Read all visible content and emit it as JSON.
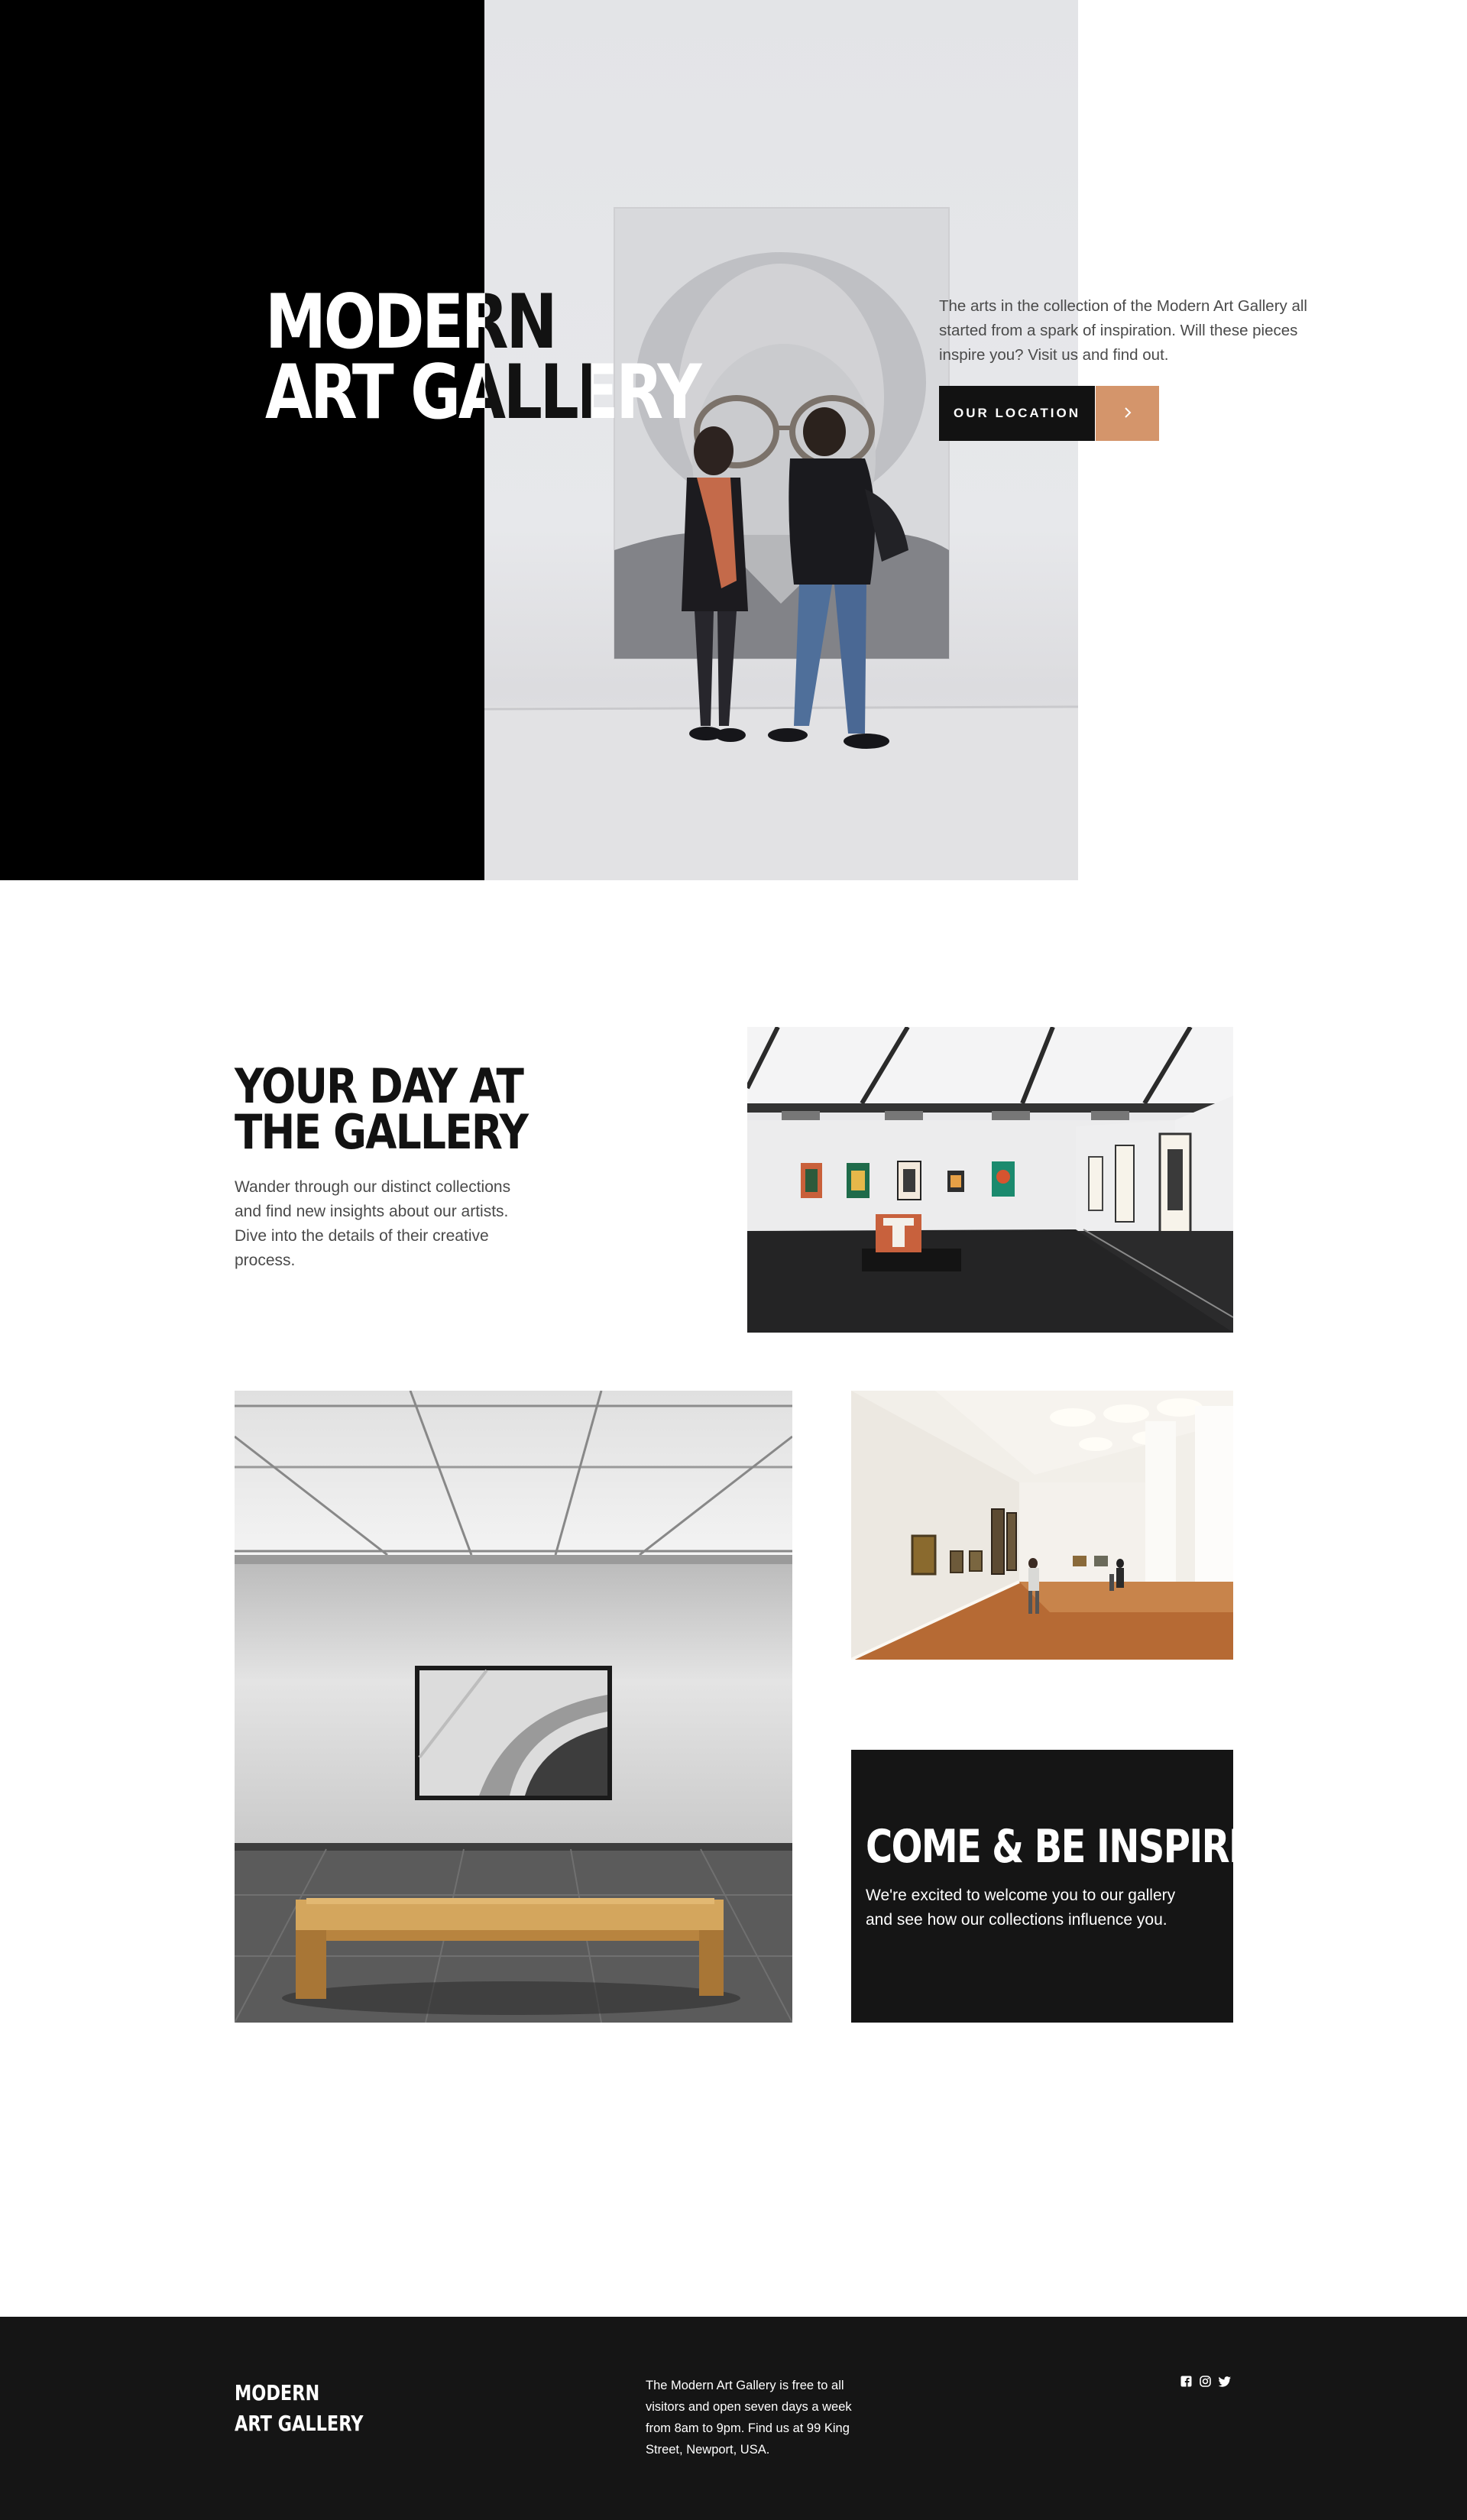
{
  "hero": {
    "title_line1": "Modern",
    "title_line2": "Art Gallery",
    "description": "The arts in the collection of the Modern Art Gallery all started from a spark of inspiration. Will these pieces inspire you? Visit us and find out.",
    "location_button": "Our Location",
    "arrow_icon": "chevron-right-icon"
  },
  "intro": {
    "title": "Your Day at the Gallery",
    "description": "Wander through our distinct collections and find new insights about our artists. Dive into the details of their creative process."
  },
  "inspired": {
    "title": "Come & Be Inspired",
    "description": "We're excited to welcome you to our gallery and see how our collections influence you."
  },
  "footer": {
    "logo_line1": "Modern",
    "logo_line2": "Art Gallery",
    "info": "The Modern Art Gallery is free to all visitors and open seven days a week from 8am to 9pm. Find us at 99 King Street, Newport, USA.",
    "social_icons": [
      "facebook-icon",
      "instagram-icon",
      "twitter-icon"
    ]
  },
  "colors": {
    "accent": "#d4956b",
    "dark": "#121212",
    "footer_bg": "#151515"
  }
}
